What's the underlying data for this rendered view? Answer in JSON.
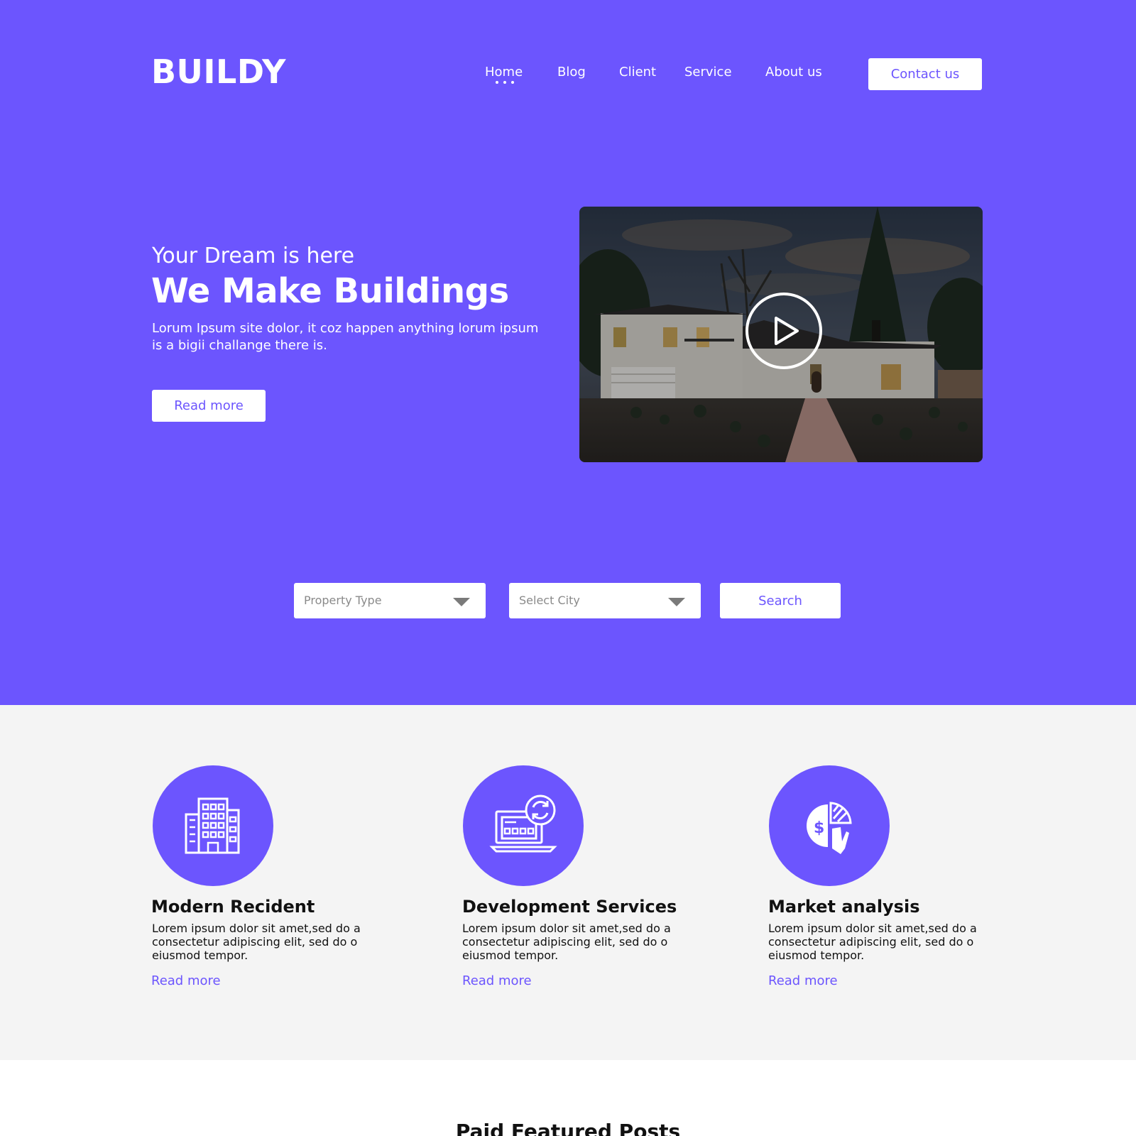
{
  "brand": {
    "logo": "BUILDY"
  },
  "nav": {
    "items": [
      {
        "label": "Home",
        "active": true
      },
      {
        "label": "Blog"
      },
      {
        "label": "Client"
      },
      {
        "label": "Service"
      },
      {
        "label": "About us"
      }
    ],
    "contact_label": "Contact us"
  },
  "hero": {
    "subtitle": "Your Dream is here",
    "title": "We Make Buildings",
    "description": "Lorum Ipsum site dolor, it coz happen anything lorum ipsum is a bigii challange there is.",
    "button_label": "Read more",
    "video_icon": "play-icon"
  },
  "search": {
    "property_type": "Property Type",
    "city": "Select City",
    "button_label": "Search"
  },
  "services": [
    {
      "icon": "building-icon",
      "title": "Modern Recident",
      "text": "Lorem ipsum dolor sit amet,sed do a consectetur adipiscing elit, sed do o eiusmod tempor.",
      "link": "Read more"
    },
    {
      "icon": "laptop-refresh-icon",
      "title": "Development Services",
      "text": "Lorem ipsum dolor sit amet,sed do a consectetur adipiscing elit, sed do o eiusmod tempor.",
      "link": "Read more"
    },
    {
      "icon": "pie-chart-hand-icon",
      "title": "Market analysis",
      "text": "Lorem ipsum dolor sit amet,sed do a consectetur adipiscing elit, sed do o eiusmod tempor.",
      "link": "Read more"
    }
  ],
  "featured": {
    "title": "Paid Featured Posts"
  },
  "colors": {
    "accent": "#6c55fe",
    "section_bg": "#f4f4f4",
    "text_dark": "#111111"
  }
}
